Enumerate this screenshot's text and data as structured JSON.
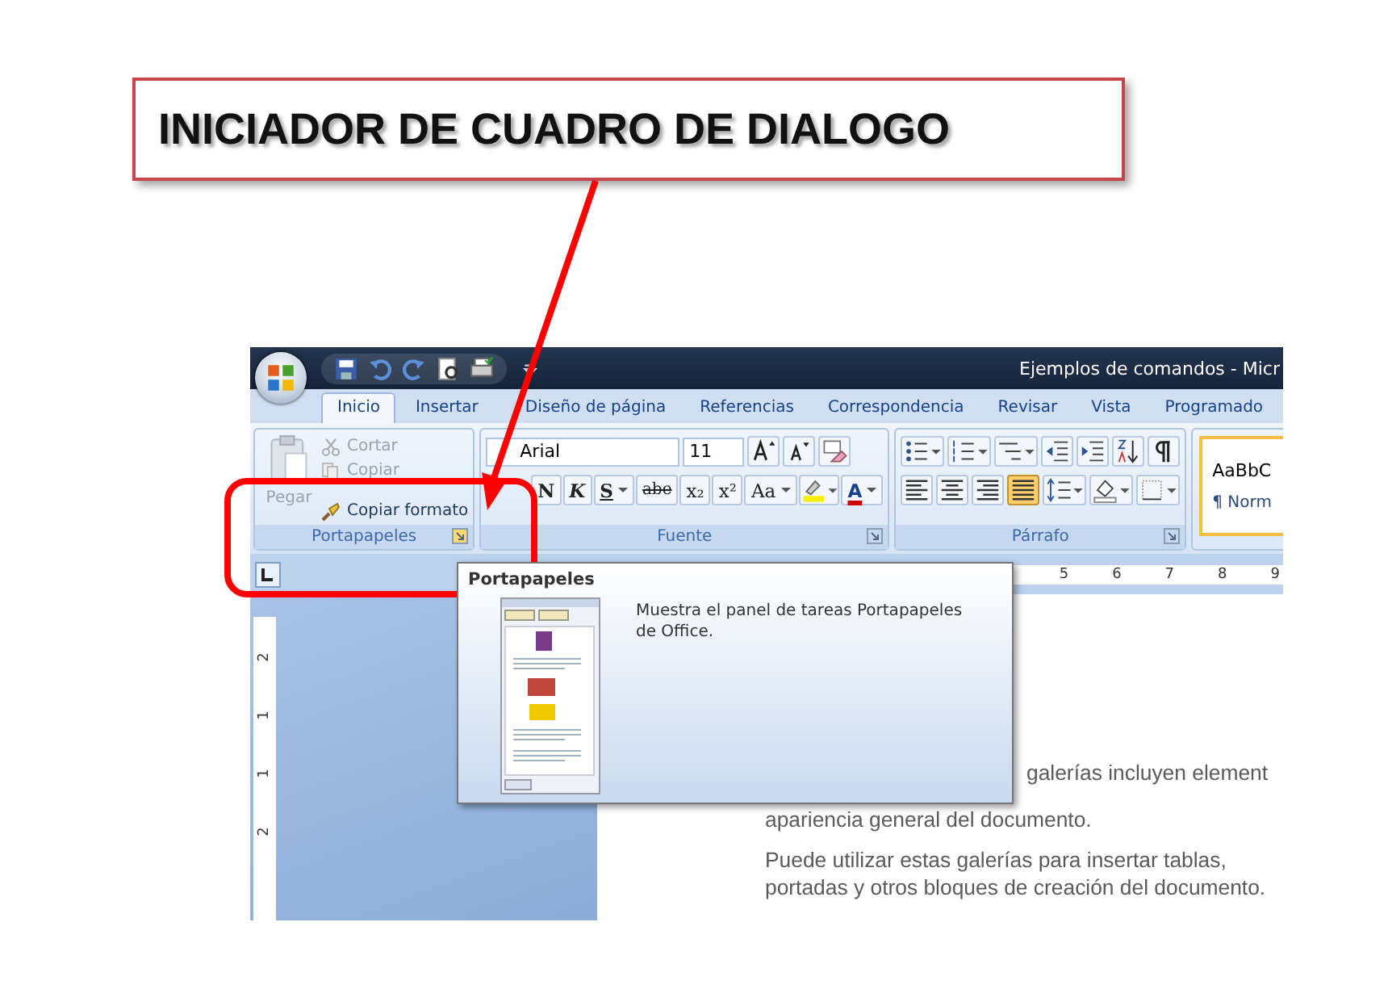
{
  "callout": {
    "text": "INICIADOR DE CUADRO DE DIALOGO"
  },
  "window": {
    "title": "Ejemplos de comandos - Micr"
  },
  "tabs": [
    {
      "label": "Inicio",
      "selected": true
    },
    {
      "label": "Insertar",
      "selected": false
    },
    {
      "label": "Diseño de página",
      "selected": false
    },
    {
      "label": "Referencias",
      "selected": false
    },
    {
      "label": "Correspondencia",
      "selected": false
    },
    {
      "label": "Revisar",
      "selected": false
    },
    {
      "label": "Vista",
      "selected": false
    },
    {
      "label": "Programado",
      "selected": false
    }
  ],
  "clipboard": {
    "label": "Portapapeles",
    "launcher_highlighted": true,
    "paste": {
      "label": "Pegar",
      "disabled": true
    },
    "commands": [
      {
        "kind": "cut",
        "label": "Cortar",
        "disabled": true
      },
      {
        "kind": "copy",
        "label": "Copiar",
        "disabled": true
      },
      {
        "kind": "format",
        "label": "Copiar formato",
        "disabled": false
      }
    ]
  },
  "font": {
    "label": "Fuente",
    "name": "Arial",
    "size": "11",
    "format_buttons": [
      {
        "label": "N",
        "kind": "bold",
        "dropdown": false
      },
      {
        "label": "K",
        "kind": "italic",
        "dropdown": false
      },
      {
        "label": "S",
        "kind": "underline",
        "dropdown": true
      },
      {
        "label": "abe",
        "kind": "strike",
        "dropdown": false
      },
      {
        "label": "x₂",
        "kind": "plain",
        "dropdown": false
      },
      {
        "label": "x²",
        "kind": "plain",
        "dropdown": false
      },
      {
        "label": "Aa",
        "kind": "case",
        "dropdown": true
      }
    ],
    "color_label": "A"
  },
  "paragraph": {
    "label": "Párrafo",
    "align": [
      {
        "kind": "left",
        "selected": false
      },
      {
        "kind": "center",
        "selected": false
      },
      {
        "kind": "right",
        "selected": false
      },
      {
        "kind": "justify",
        "selected": true
      }
    ]
  },
  "styles": {
    "sample": "AaBbC",
    "name": "¶ Norm"
  },
  "ruler": {
    "marks": [
      "5",
      "6",
      "7",
      "8",
      "9"
    ]
  },
  "vertical_ruler": {
    "marks": [
      "2",
      "1",
      "1",
      "2"
    ]
  },
  "tooltip": {
    "title": "Portapapeles",
    "description": "Muestra el panel de tareas Portapapeles de Office."
  },
  "document": {
    "paragraphs": [
      {
        "lines": [
          "galerías incluyen element",
          "apariencia general del documento."
        ]
      },
      {
        "lines": [
          "Puede utilizar estas galerías para insertar tablas,",
          "portadas y otros bloques de creación del documento."
        ]
      }
    ]
  }
}
